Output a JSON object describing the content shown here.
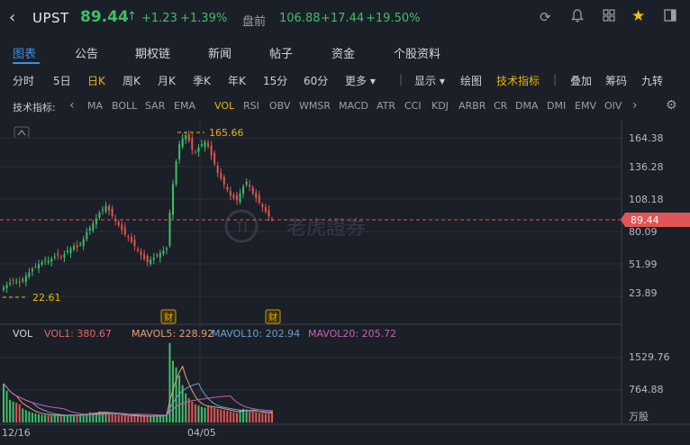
{
  "header": {
    "back_icon": "chevron-left-icon",
    "symbol": "UPST",
    "price": "89.44",
    "arrow": "↑",
    "change": "+1.23",
    "change_pct": "+1.39%",
    "premarket_label": "盘前",
    "premarket_price": "106.88",
    "premarket_change": "+17.44",
    "premarket_pct": "+19.50%",
    "icons": [
      "refresh-icon",
      "bell-icon",
      "grid-icon",
      "star-icon",
      "layout-icon"
    ],
    "up_color": "#3fbf68",
    "down_color": "#e05555",
    "accent": "#e8b50c"
  },
  "tabs": [
    "图表",
    "公告",
    "期权链",
    "新闻",
    "帖子",
    "资金",
    "个股资料"
  ],
  "active_tab": "图表",
  "periods": [
    "分时",
    "5日",
    "日K",
    "周K",
    "月K",
    "季K",
    "年K",
    "15分",
    "60分",
    "更多 ▾"
  ],
  "active_period": "日K",
  "tools": [
    "显示 ▾",
    "绘图",
    "技术指标",
    "叠加",
    "筹码",
    "九转"
  ],
  "active_tool": "技术指标",
  "indicators_label": "技术指标:",
  "indicators": [
    "MA",
    "BOLL",
    "SAR",
    "EMA",
    "VOL",
    "RSI",
    "OBV",
    "WMSR",
    "MACD",
    "ATR",
    "CCI",
    "KDJ",
    "ARBR",
    "CR",
    "DMA",
    "DMI",
    "EMV",
    "OIV"
  ],
  "active_indicator": "VOL",
  "watermark": "老虎證券",
  "chart_data": [
    {
      "type": "candlestick",
      "y_axis_ticks": [
        "164.38",
        "136.28",
        "108.18",
        "80.09",
        "51.99",
        "23.89"
      ],
      "ylim": [
        15,
        170
      ],
      "current_price_label": "89.44",
      "high_label": "165.66",
      "low_label": "22.61",
      "event_markers": [
        "财",
        "财"
      ],
      "x_labels": [
        "12/16",
        "04/05"
      ],
      "closes": [
        30,
        32,
        34,
        36,
        35,
        34,
        37,
        40,
        43,
        46,
        48,
        50,
        52,
        54,
        53,
        55,
        57,
        58,
        56,
        59,
        62,
        64,
        66,
        65,
        68,
        72,
        78,
        82,
        86,
        90,
        95,
        98,
        101,
        97,
        92,
        88,
        84,
        80,
        76,
        74,
        70,
        66,
        62,
        58,
        55,
        52,
        54,
        56,
        58,
        60,
        62,
        64,
        95,
        120,
        140,
        155,
        160,
        163,
        158,
        150,
        148,
        152,
        155,
        157,
        153,
        145,
        138,
        130,
        125,
        120,
        115,
        110,
        108,
        106,
        112,
        118,
        122,
        118,
        112,
        108,
        104,
        100,
        96,
        92,
        89.44
      ]
    },
    {
      "type": "bar",
      "title": "VOL",
      "series": [
        {
          "name": "VOL1",
          "value": "380.67"
        },
        {
          "name": "MAVOL5",
          "value": "228.92"
        },
        {
          "name": "MAVOL10",
          "value": "202.94"
        },
        {
          "name": "MAVOL20",
          "value": "205.72"
        }
      ],
      "y_axis_ticks": [
        "1529.76",
        "764.88"
      ],
      "unit": "万股",
      "volumes": [
        1200,
        980,
        700,
        640,
        610,
        560,
        430,
        380,
        340,
        300,
        280,
        260,
        240,
        230,
        220,
        210,
        220,
        240,
        200,
        210,
        230,
        250,
        240,
        210,
        220,
        260,
        280,
        320,
        300,
        280,
        340,
        320,
        310,
        280,
        260,
        240,
        230,
        220,
        210,
        200,
        220,
        200,
        190,
        180,
        210,
        200,
        190,
        200,
        210,
        220,
        230,
        250,
        2450,
        1900,
        1700,
        1450,
        1150,
        900,
        750,
        640,
        560,
        520,
        480,
        460,
        520,
        480,
        450,
        420,
        400,
        380,
        360,
        340,
        320,
        300,
        380,
        420,
        400,
        360,
        340,
        320,
        300,
        280,
        260,
        260,
        380.67
      ]
    }
  ]
}
